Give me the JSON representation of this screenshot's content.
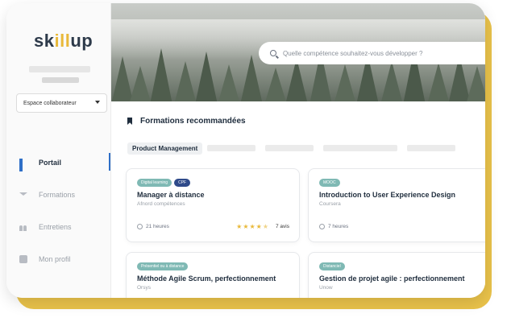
{
  "brand": {
    "logo_prefix": "sk",
    "logo_mid": "ill",
    "logo_suffix": "up",
    "accent": "#e9b93a"
  },
  "sidebar": {
    "space_select": "Espace collaborateur",
    "items": [
      {
        "label": "Portail",
        "icon": "grid-icon",
        "active": true
      },
      {
        "label": "Formations",
        "icon": "graduation-cap-icon",
        "active": false
      },
      {
        "label": "Entretiens",
        "icon": "people-icon",
        "active": false
      },
      {
        "label": "Mon profil",
        "icon": "profile-icon",
        "active": false
      }
    ]
  },
  "search": {
    "placeholder": "Quelle compétence souhaitez-vous développer ?"
  },
  "section": {
    "title": "Formations recommandées"
  },
  "tabs": {
    "active_label": "Product Management"
  },
  "cards": [
    {
      "badges": [
        "Digital learning",
        "CPF"
      ],
      "title": "Manager à distance",
      "provider": "Afnord compétences",
      "duration": "21 heures",
      "rating": 4.5,
      "reviews": "7 avis"
    },
    {
      "badges": [
        "MOOC"
      ],
      "title": "Introduction to User Experience Design",
      "provider": "Coursera",
      "duration": "7 heures"
    },
    {
      "badges": [
        "Présentiel ou à distance"
      ],
      "title": "Méthode Agile Scrum, perfectionnement",
      "provider": "Orsys"
    },
    {
      "badges": [
        "Distanciel"
      ],
      "title": "Gestion de projet agile : perfectionnement",
      "provider": "Unow"
    }
  ]
}
